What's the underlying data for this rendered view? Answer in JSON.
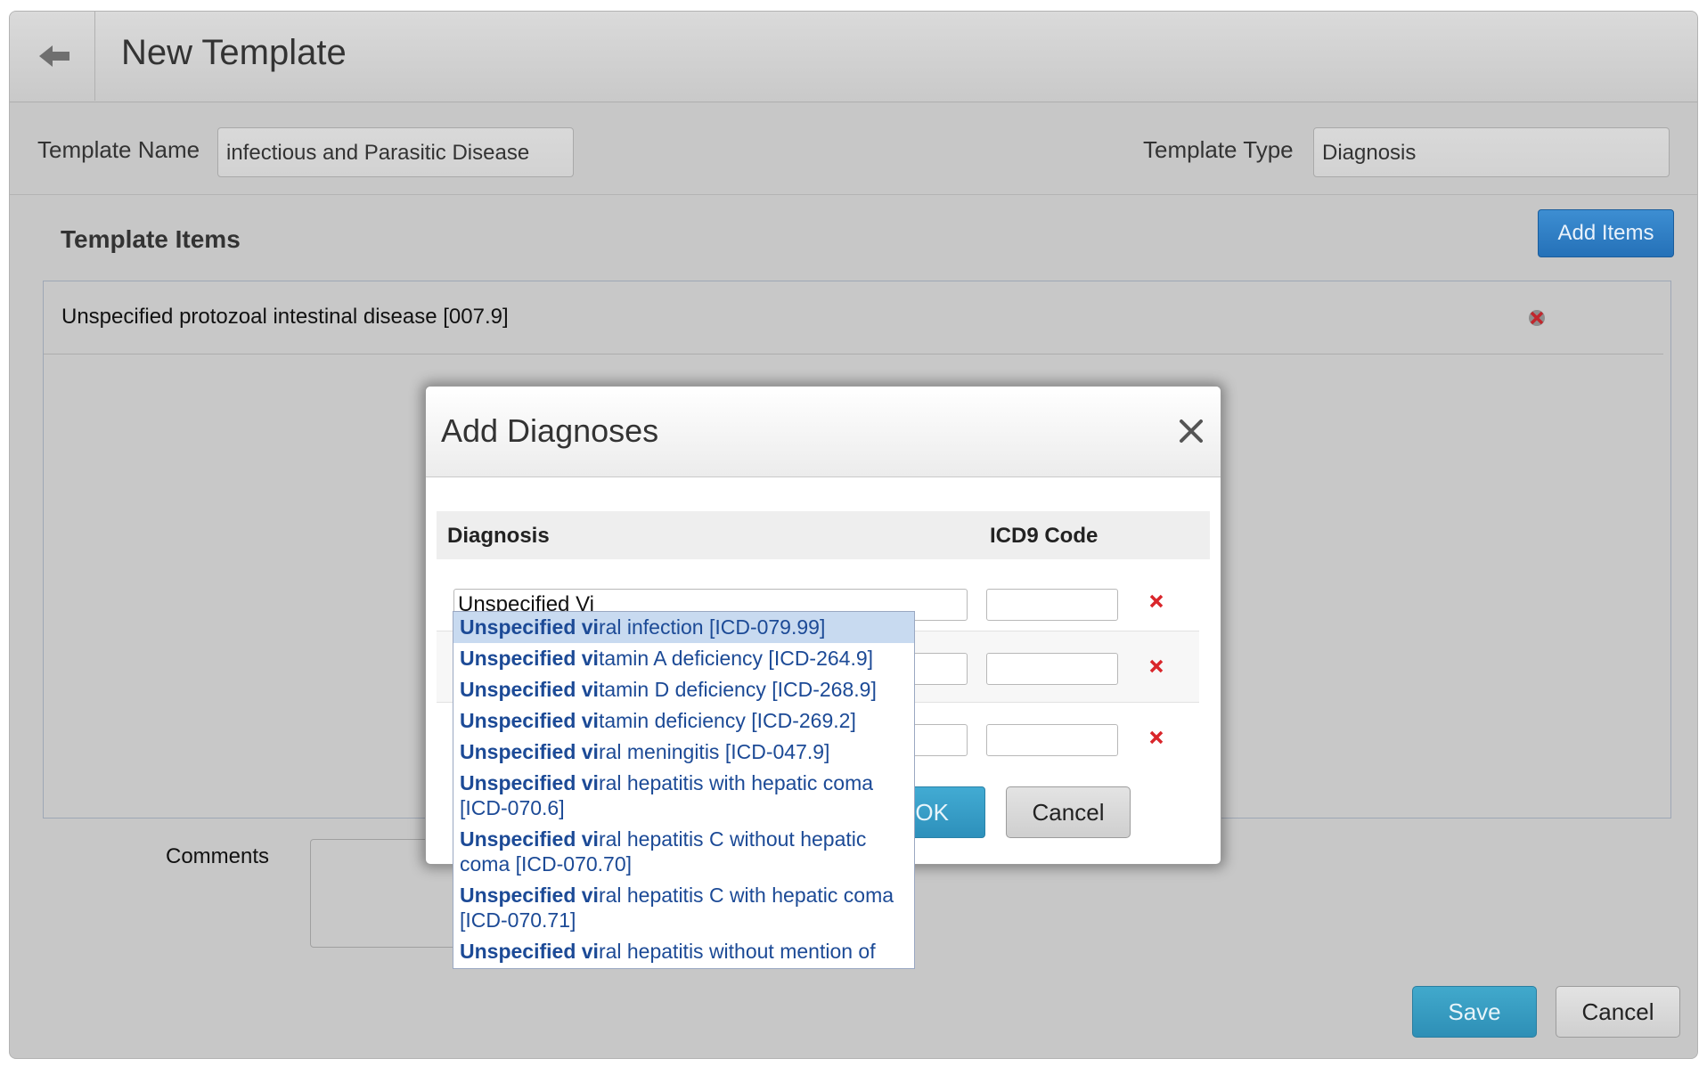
{
  "header": {
    "title": "New Template"
  },
  "form": {
    "template_name_label": "Template Name",
    "template_name_value": "infectious and Parasitic Disease",
    "template_type_label": "Template Type",
    "template_type_value": "Diagnosis"
  },
  "template_items": {
    "title": "Template Items",
    "add_button": "Add Items",
    "items": [
      {
        "label": "Unspecified protozoal intestinal disease [007.9]"
      }
    ]
  },
  "comments": {
    "label": "Comments",
    "value": ""
  },
  "footer": {
    "save_label": "Save",
    "cancel_label": "Cancel"
  },
  "modal": {
    "title": "Add Diagnoses",
    "col_diagnosis": "Diagnosis",
    "col_icd9": "ICD9 Code",
    "rows": [
      {
        "diagnosis": "Unspecified Vi",
        "icd9": ""
      },
      {
        "diagnosis": "",
        "icd9": ""
      },
      {
        "diagnosis": "",
        "icd9": ""
      }
    ],
    "ok_label": "OK",
    "cancel_label": "Cancel"
  },
  "autocomplete": {
    "query_match": "Unspecified vi",
    "suggestions": [
      {
        "match": "Unspecified vi",
        "rest": "ral infection [ICD-079.99]"
      },
      {
        "match": "Unspecified vi",
        "rest": "tamin A deficiency [ICD-264.9]"
      },
      {
        "match": "Unspecified vi",
        "rest": "tamin D deficiency [ICD-268.9]"
      },
      {
        "match": "Unspecified vi",
        "rest": "tamin deficiency [ICD-269.2]"
      },
      {
        "match": "Unspecified vi",
        "rest": "ral meningitis [ICD-047.9]"
      },
      {
        "match": "Unspecified vi",
        "rest": "ral hepatitis with hepatic coma [ICD-070.6]"
      },
      {
        "match": "Unspecified vi",
        "rest": "ral hepatitis C without hepatic coma [ICD-070.70]"
      },
      {
        "match": "Unspecified vi",
        "rest": "ral hepatitis C with hepatic coma [ICD-070.71]"
      },
      {
        "match": "Unspecified vi",
        "rest": "ral hepatitis without mention of"
      }
    ]
  },
  "icons": {
    "back": "arrow-left-icon",
    "item_delete": "remove-x-icon",
    "row_delete": "red-x-icon",
    "modal_close": "close-icon"
  },
  "colors": {
    "primary_blue": "#2571b8",
    "save_teal": "#2e8fb6",
    "delete_red": "#d9262b",
    "link_blue": "#1c4a96",
    "selection": "#c8daf0"
  }
}
